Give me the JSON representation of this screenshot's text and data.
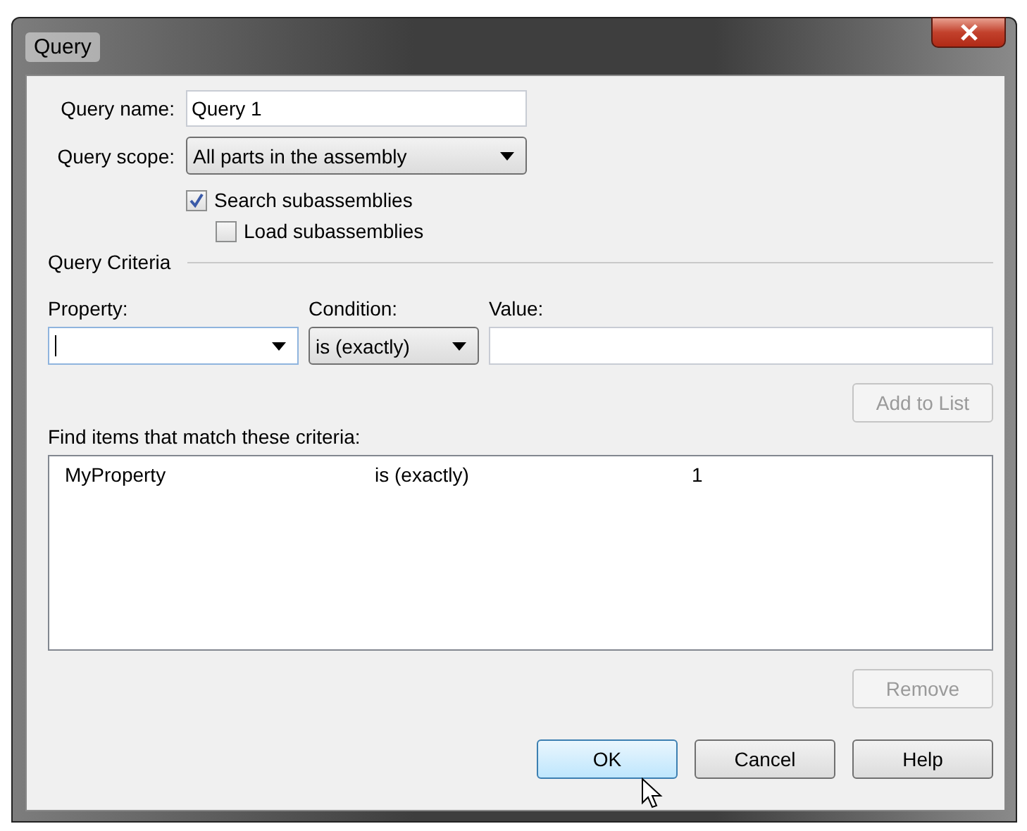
{
  "window": {
    "title": "Query"
  },
  "query_name": {
    "label": "Query name:",
    "value": "Query 1"
  },
  "query_scope": {
    "label": "Query scope:",
    "value": "All parts in the assembly"
  },
  "checkboxes": [
    {
      "label": "Search subassemblies",
      "checked": true
    },
    {
      "label": "Load subassemblies",
      "checked": false
    }
  ],
  "criteria": {
    "title": "Query Criteria",
    "property": {
      "label": "Property:"
    },
    "condition": {
      "label": "Condition:",
      "value": "is (exactly)"
    },
    "value": {
      "label": "Value:"
    },
    "add_button": {
      "label": "Add to List",
      "disabled": true
    },
    "list_label": "Find items that match these criteria:",
    "rows": [
      {
        "property": "MyProperty",
        "condition": "is (exactly)",
        "value": "1"
      }
    ],
    "remove_button": {
      "label": "Remove",
      "disabled": true
    }
  },
  "buttons": [
    {
      "label": "OK",
      "focused": true
    },
    {
      "label": "Cancel",
      "focused": false
    },
    {
      "label": "Help",
      "focused": false
    }
  ]
}
